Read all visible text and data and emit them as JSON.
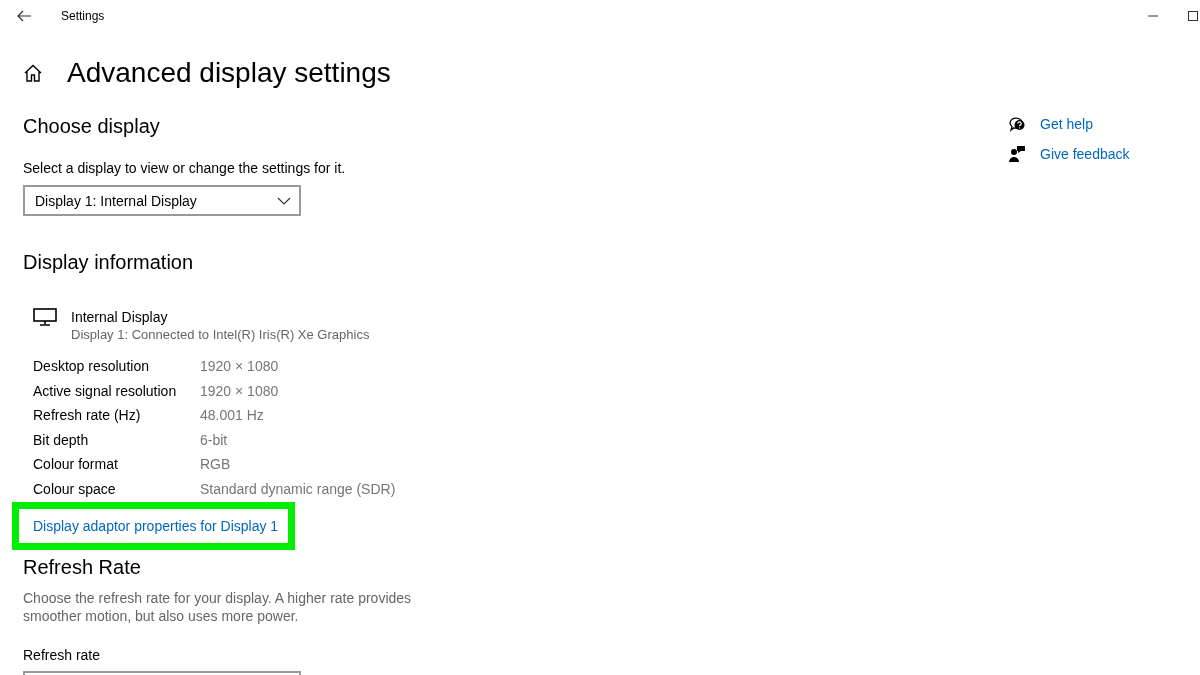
{
  "window": {
    "title": "Settings"
  },
  "page": {
    "title": "Advanced display settings"
  },
  "choose_display": {
    "heading": "Choose display",
    "label": "Select a display to view or change the settings for it.",
    "dropdown": {
      "value": "Display 1: Internal Display"
    }
  },
  "display_information": {
    "heading": "Display information",
    "display": {
      "name": "Internal Display",
      "description": "Display 1: Connected to Intel(R) Iris(R) Xe Graphics"
    },
    "rows": [
      {
        "label": "Desktop resolution",
        "value": "1920 × 1080"
      },
      {
        "label": "Active signal resolution",
        "value": "1920 × 1080"
      },
      {
        "label": "Refresh rate (Hz)",
        "value": "48.001 Hz"
      },
      {
        "label": "Bit depth",
        "value": "6-bit"
      },
      {
        "label": "Colour format",
        "value": "RGB"
      },
      {
        "label": "Colour space",
        "value": "Standard dynamic range (SDR)"
      }
    ],
    "link": {
      "text": "Display adaptor properties for Display 1",
      "highlighted": true
    }
  },
  "refresh_rate": {
    "heading": "Refresh Rate",
    "description": "Choose the refresh rate for your display. A higher rate provides smoother motion, but also uses more power.",
    "field_label": "Refresh rate"
  },
  "help_links": [
    {
      "kind": "help",
      "text": "Get help"
    },
    {
      "kind": "feedback",
      "text": "Give feedback"
    }
  ]
}
